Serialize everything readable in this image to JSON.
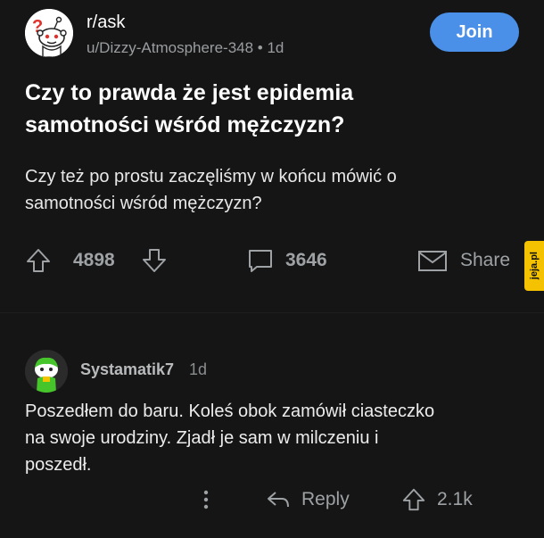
{
  "header": {
    "subreddit": "r/ask",
    "author_meta": "u/Dizzy-Atmosphere-348 • 1d",
    "join_label": "Join"
  },
  "post": {
    "title_line1": "Czy to prawda że jest epidemia",
    "title_line2": "samotności wśród mężczyzn?",
    "body_line1": "Czy też po prostu zaczęliśmy w końcu mówić o",
    "body_line2": "samotności wśród mężczyzn?"
  },
  "actions": {
    "upvotes": "4898",
    "comments": "3646",
    "share_label": "Share"
  },
  "watermark": {
    "text": "jeja.pl"
  },
  "comment": {
    "username": "Systamatik7",
    "time": "1d",
    "line1": "Poszedłem do baru. Koleś obok zamówił ciasteczko",
    "line2": "na swoje urodziny. Zjadł je sam w milczeniu i",
    "line3": "poszedł.",
    "reply_label": "Reply",
    "votes": "2.1k"
  },
  "colors": {
    "background": "#151515",
    "join_button": "#4a90e8",
    "watermark": "#f4c200"
  }
}
